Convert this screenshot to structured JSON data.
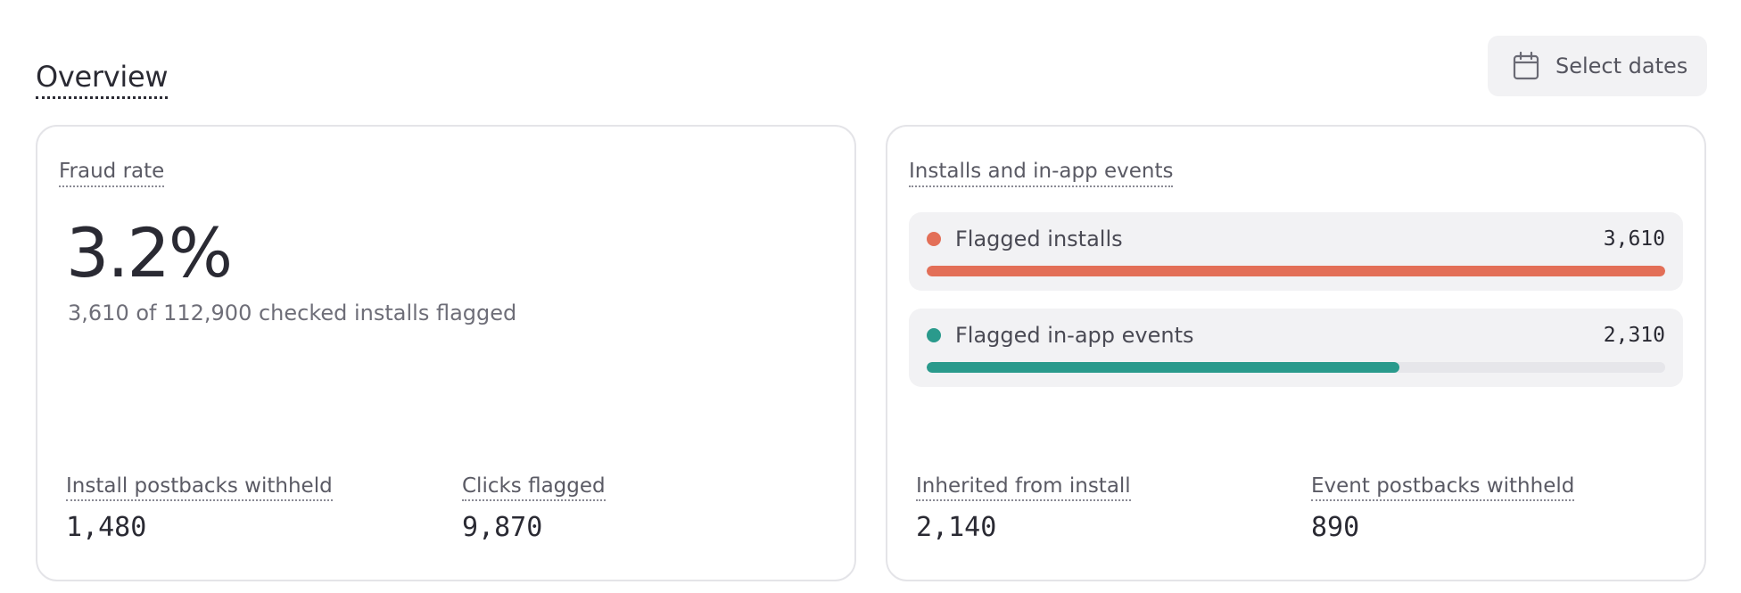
{
  "header": {
    "title": "Overview",
    "date_button_label": "Select dates",
    "date_icon": "calendar-icon"
  },
  "fraud_card": {
    "label": "Fraud rate",
    "value": "3.2%",
    "subtitle": "3,610 of 112,900 checked installs flagged",
    "stats": [
      {
        "label": "Install postbacks withheld",
        "value": "1,480"
      },
      {
        "label": "Clicks flagged",
        "value": "9,870"
      }
    ]
  },
  "events_card": {
    "label": "Installs and in-app events",
    "bars": [
      {
        "name": "Flagged installs",
        "count": "3,610",
        "fraction": 1.0,
        "color": "#e36f57"
      },
      {
        "name": "Flagged in-app events",
        "count": "2,310",
        "fraction": 0.64,
        "color": "#2a9a8c"
      }
    ],
    "stats": [
      {
        "label": "Inherited from install",
        "value": "2,140"
      },
      {
        "label": "Event postbacks withheld",
        "value": "890"
      }
    ]
  }
}
